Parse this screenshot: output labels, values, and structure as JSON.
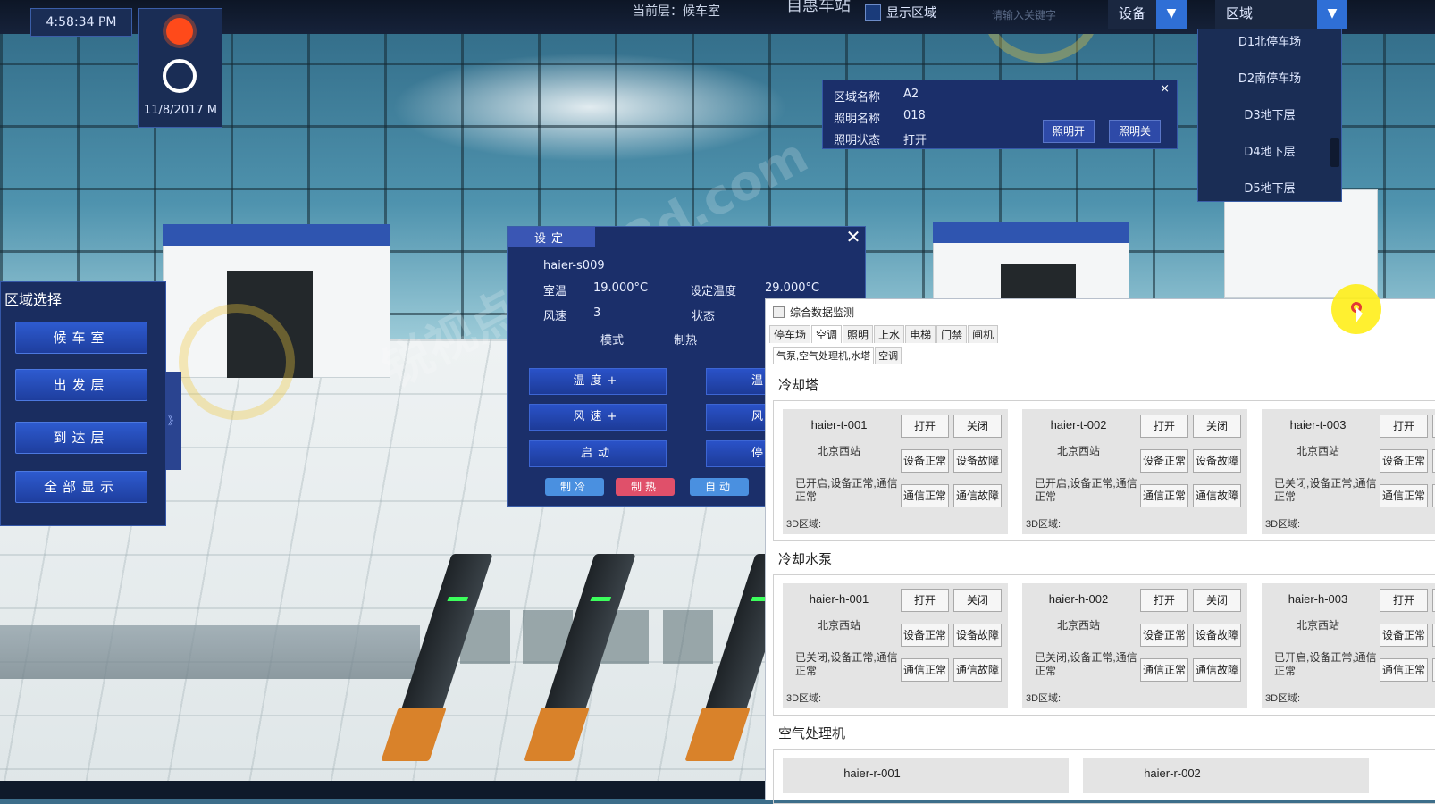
{
  "topbar": {
    "clock": "4:58:34 PM",
    "date": "11/8/2017 M",
    "current_floor": "当前层：候车室",
    "current_floor_right": "自惠车站",
    "show_area_label": "显示区域",
    "search_placeholder": "请输入关键字",
    "device_label": "设备",
    "area_label": "区域"
  },
  "area_list": [
    "D1北停车场",
    "D2南停车场",
    "D3地下层",
    "D4地下层",
    "D5地下层"
  ],
  "lighting": {
    "rows": [
      {
        "k": "区域名称",
        "v": "A2"
      },
      {
        "k": "照明名称",
        "v": "018"
      },
      {
        "k": "照明状态",
        "v": "打开"
      }
    ],
    "on_label": "照明开",
    "off_label": "照明关",
    "close": "×"
  },
  "area_panel": {
    "title": "区域选择",
    "buttons": [
      "候车室",
      "出发层",
      "到达层",
      "全部显示"
    ],
    "collapse": "》"
  },
  "ac_panel": {
    "header": "设定",
    "close": "✕",
    "device": "haier-s009",
    "room_temp_label": "室温",
    "room_temp": "19.000°C",
    "set_temp_label": "设定温度",
    "set_temp": "29.000°C",
    "fan_label": "风速",
    "fan": "3",
    "status_label": "状态",
    "mode_label": "模式",
    "mode": "制热",
    "controls": [
      "温度+",
      "风速+",
      "启动"
    ],
    "side_controls": [
      "温",
      "风",
      "停"
    ],
    "modes": [
      "制冷",
      "制热",
      "自动"
    ],
    "colors": {
      "cool": "#4a90e0",
      "heat": "#e0506a",
      "auto": "#4a90e0"
    }
  },
  "monitor": {
    "title": "综合数据监测",
    "tabs": [
      "停车场",
      "空调",
      "照明",
      "上水",
      "电梯",
      "门禁",
      "闸机"
    ],
    "active_tab": 1,
    "subtabs": [
      "气泵,空气处理机,水塔",
      "空调"
    ],
    "sections": [
      {
        "title": "冷却塔",
        "cards": [
          {
            "name": "haier-t-001",
            "loc": "北京西站",
            "status": "已开启,设备正常,通信正常",
            "area": "3D区域:"
          },
          {
            "name": "haier-t-002",
            "loc": "北京西站",
            "status": "已开启,设备正常,通信正常",
            "area": "3D区域:"
          },
          {
            "name": "haier-t-003",
            "loc": "北京西站",
            "status": "已关闭,设备正常,通信正常",
            "area": "3D区域:"
          }
        ]
      },
      {
        "title": "冷却水泵",
        "cards": [
          {
            "name": "haier-h-001",
            "loc": "北京西站",
            "status": "已关闭,设备正常,通信正常",
            "area": "3D区域:"
          },
          {
            "name": "haier-h-002",
            "loc": "北京西站",
            "status": "已关闭,设备正常,通信正常",
            "area": "3D区域:"
          },
          {
            "name": "haier-h-003",
            "loc": "北京西站",
            "status": "已开启,设备正常,通信正常",
            "area": "3D区域:"
          }
        ]
      }
    ],
    "section3_title": "空气处理机",
    "section3_cards": [
      "haier-r-001",
      "haier-r-002"
    ],
    "buttons": {
      "open": "打开",
      "close": "关闭",
      "dev_ok": "设备正常",
      "dev_fault": "设备故障",
      "com_ok": "通信正常",
      "com_fault": "通信故障"
    }
  },
  "watermark": "锐视点 new3d.com"
}
